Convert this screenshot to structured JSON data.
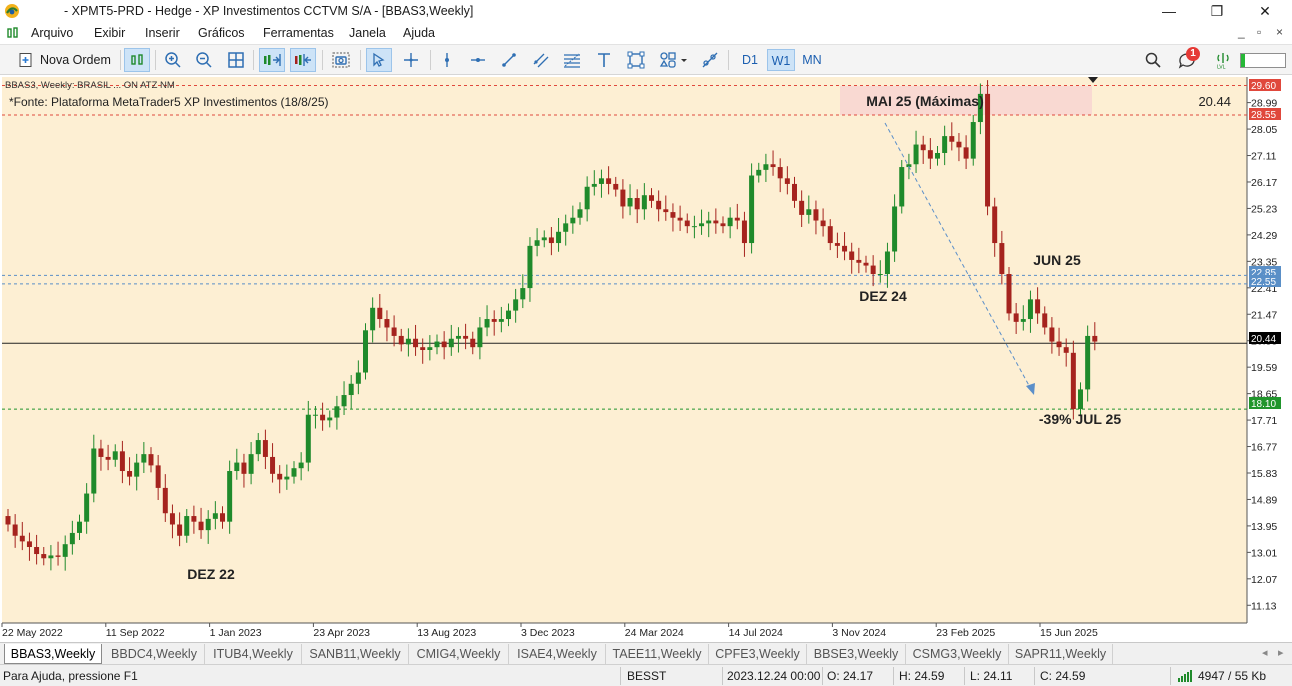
{
  "window": {
    "title": "- XPMT5-PRD - Hedge - XP Investimentos CCTVM S/A - [BBAS3,Weekly]",
    "minimize": "—",
    "restore": "❐",
    "close": "✕"
  },
  "menu": {
    "items": [
      "Arquivo",
      "Exibir",
      "Inserir",
      "Gráficos",
      "Ferramentas",
      "Janela",
      "Ajuda"
    ],
    "controls": [
      "_",
      "▫",
      "×"
    ]
  },
  "toolbar": {
    "new_order": "Nova Ordem",
    "timeframes": [
      "D1",
      "W1",
      "MN"
    ],
    "active_timeframe": "W1",
    "notification_count": "1"
  },
  "chart": {
    "symbol_line": "BBAS3, Weekly: BRASIL ... ON ATZ NM",
    "source_note": "*Fonte: Plataforma MetaTrader5 XP Investimentos (18/8/25)",
    "top_right_value": "20.44",
    "annotations": {
      "max_box": "MAI 25 (Máximas)",
      "dez22": "DEZ 22",
      "dez24": "DEZ 24",
      "jun25": "JUN 25",
      "jul25": "-39% JUL 25"
    },
    "price_ticks": [
      "28.99",
      "28.05",
      "27.11",
      "26.17",
      "25.23",
      "24.29",
      "23.35",
      "22.41",
      "21.47",
      "20.53",
      "19.59",
      "18.65",
      "17.71",
      "16.77",
      "15.83",
      "14.89",
      "13.95",
      "13.01",
      "12.07",
      "11.13"
    ],
    "price_labels": {
      "p2960": "29.60",
      "p2855": "28.55",
      "p2285": "22.85",
      "p2255": "22.55",
      "current": "20.44",
      "p1810": "18.10"
    },
    "date_ticks": [
      "22 May 2022",
      "11 Sep 2022",
      "1 Jan 2023",
      "23 Apr 2023",
      "13 Aug 2023",
      "3 Dec 2023",
      "24 Mar 2024",
      "14 Jul 2024",
      "3 Nov 2024",
      "23 Feb 2025",
      "15 Jun 2025"
    ],
    "colors": {
      "background": "#fdefd3",
      "bull": "#1f8a2b",
      "bear": "#a5231e",
      "max_box": "#f9d9d2",
      "red_tag": "#e0483c",
      "blue_tag": "#5a8fc7",
      "green_tag": "#20952c"
    }
  },
  "chart_data": {
    "type": "candlestick",
    "symbol": "BBAS3",
    "timeframe": "Weekly",
    "y_range": [
      10.5,
      29.9
    ],
    "horizontal_levels": [
      29.6,
      28.55,
      22.85,
      22.55,
      20.44,
      18.1
    ],
    "closes": [
      14.0,
      13.6,
      13.4,
      13.2,
      12.95,
      12.8,
      12.9,
      12.85,
      13.3,
      13.7,
      14.1,
      15.1,
      16.7,
      16.4,
      16.3,
      16.6,
      15.9,
      15.7,
      16.2,
      16.5,
      16.1,
      15.3,
      14.4,
      14.0,
      13.6,
      14.3,
      14.1,
      13.8,
      14.2,
      14.4,
      14.1,
      15.9,
      16.2,
      15.8,
      16.5,
      17.0,
      16.4,
      15.8,
      15.6,
      15.7,
      16.0,
      16.2,
      17.9,
      17.9,
      17.7,
      17.8,
      18.2,
      18.6,
      19.0,
      19.4,
      20.9,
      21.7,
      21.3,
      21.0,
      20.7,
      20.4,
      20.6,
      20.3,
      20.2,
      20.3,
      20.5,
      20.3,
      20.6,
      20.7,
      20.6,
      20.3,
      21.0,
      21.3,
      21.2,
      21.3,
      21.6,
      22.0,
      22.4,
      23.9,
      24.1,
      24.2,
      24.0,
      24.4,
      24.7,
      24.9,
      25.2,
      26.0,
      26.1,
      26.3,
      26.1,
      25.9,
      25.3,
      25.6,
      25.2,
      25.7,
      25.5,
      25.2,
      25.1,
      24.9,
      24.8,
      24.6,
      24.6,
      24.7,
      24.8,
      24.7,
      24.6,
      24.9,
      24.8,
      24.0,
      26.4,
      26.6,
      26.8,
      26.7,
      26.3,
      26.1,
      25.5,
      25.0,
      25.2,
      24.8,
      24.6,
      24.0,
      23.9,
      23.7,
      23.4,
      23.3,
      23.2,
      22.9,
      22.9,
      23.7,
      25.3,
      26.7,
      26.8,
      27.5,
      27.3,
      27.0,
      27.2,
      27.8,
      27.6,
      27.4,
      27.0,
      28.3,
      29.3,
      25.3,
      24.0,
      22.9,
      21.5,
      21.2,
      21.3,
      22.0,
      21.5,
      21.0,
      20.5,
      20.3,
      20.1,
      18.1,
      18.8,
      20.7,
      20.5
    ],
    "annotations": [
      "DEZ 22",
      "DEZ 24",
      "MAI 25 (Máximas)",
      "JUN 25",
      "-39% JUL 25"
    ],
    "source": "*Fonte: Plataforma MetaTrader5 XP Investimentos (18/8/25)"
  },
  "tabs": [
    "BBAS3,Weekly",
    "BBDC4,Weekly",
    "ITUB4,Weekly",
    "SANB11,Weekly",
    "CMIG4,Weekly",
    "ISAE4,Weekly",
    "TAEE11,Weekly",
    "CPFE3,Weekly",
    "BBSE3,Weekly",
    "CSMG3,Weekly",
    "SAPR11,Weekly"
  ],
  "status": {
    "help": "Para Ajuda, pressione F1",
    "profile": "BESST",
    "datetime": "2023.12.24 00:00",
    "open": "O: 24.17",
    "high": "H: 24.59",
    "low": "L: 24.11",
    "close": "C: 24.59",
    "traffic": "4947 / 55 Kb"
  }
}
